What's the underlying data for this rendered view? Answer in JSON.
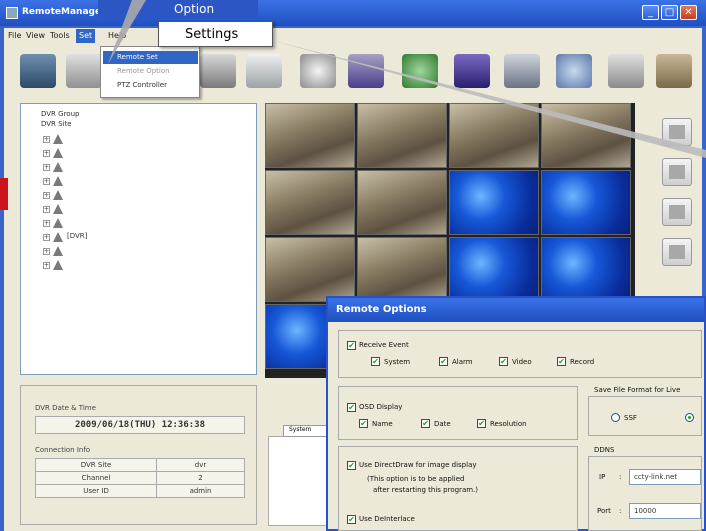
{
  "window": {
    "title": "RemoteManager",
    "min": "_",
    "max": "□",
    "close": "✕"
  },
  "menu": {
    "items": [
      "File",
      "View",
      "Tools",
      "Set",
      "Help"
    ],
    "dropdown": [
      "Remote Set",
      "Remote Option",
      "PTZ Controller"
    ]
  },
  "callout": {
    "header": "Option",
    "box_label": "Settings"
  },
  "toolbar": {
    "icons": [
      "monitor-icon",
      "search-icon",
      "unknown-icon",
      "unknown-icon",
      "camera-icon",
      "calendar-icon",
      "refresh-icon",
      "book-icon",
      "image-icon",
      "globe-icon",
      "camera-icon",
      "image-icon"
    ]
  },
  "tree": {
    "root1": "DVR Group",
    "root2": "DVR Site",
    "nodes": [
      "",
      "",
      "",
      "",
      "",
      "",
      "",
      "[DVR]",
      "",
      ""
    ]
  },
  "info": {
    "section_datetime": "DVR Date & Time",
    "datetime": "2009/06/18(THU) 12:36:38",
    "section_connection": "Connection Info",
    "rows": [
      {
        "label": "DVR Site",
        "value": "dvr"
      },
      {
        "label": "Channel",
        "value": "2"
      },
      {
        "label": "User ID",
        "value": "admin"
      }
    ]
  },
  "status": {
    "tab": "System"
  },
  "dialog": {
    "title": "Remote Options",
    "receive_event": "Receive Event",
    "receive_opts": [
      "System",
      "Alarm",
      "Video",
      "Record"
    ],
    "osd_display": "OSD Display",
    "osd_opts": [
      "Name",
      "Date",
      "Resolution"
    ],
    "save_file_format": "Save File Format for Live",
    "format_opt": "SSF",
    "use_directdraw": "Use DirectDraw for image display",
    "directdraw_note1": "(This option is to be applied",
    "directdraw_note2": "after restarting this program.)",
    "use_deinterlace": "Use DeInterlace",
    "ddns": "DDNS",
    "ip_label": "IP",
    "ip_value": "ccty-link.net",
    "port_label": "Port",
    "port_value": "10000"
  }
}
